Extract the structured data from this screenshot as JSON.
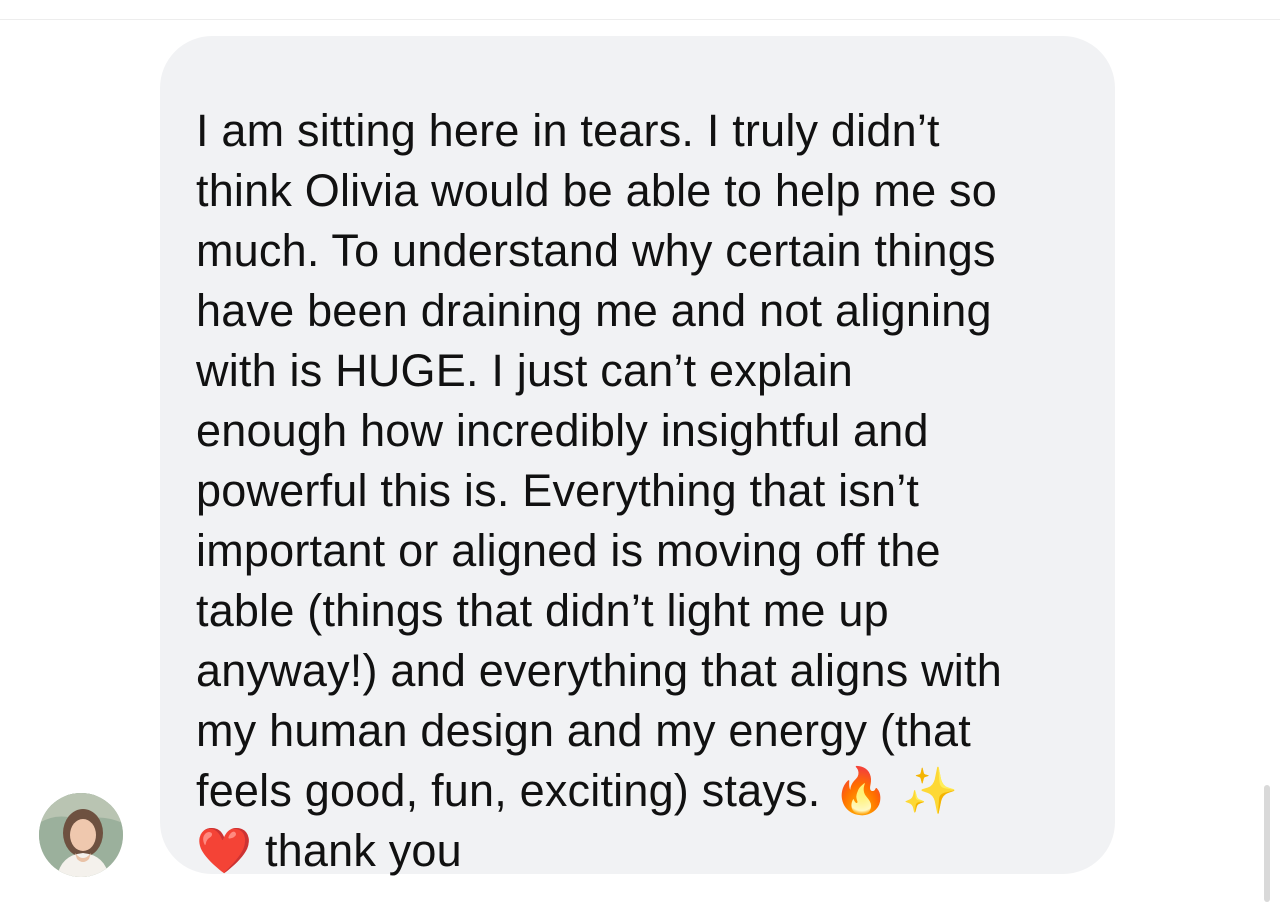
{
  "message": {
    "lines": [
      "I am sitting here in tears. I truly didn’t",
      "think Olivia would be able to help me so",
      "much. To understand why certain things",
      "have been draining me and not aligning",
      "with is HUGE. I just can’t explain",
      "enough how incredibly insightful and",
      "powerful this is. Everything that isn’t",
      "important or aligned is moving off the",
      "table (things that didn’t light me up",
      "anyway!) and everything that aligns with",
      "my human design and my energy (that",
      "feels good, fun, exciting) stays."
    ],
    "emoji_fire": "🔥",
    "emoji_sparkles": "✨",
    "emoji_heart": "❤️",
    "closing": "thank you"
  },
  "colors": {
    "bubble_background": "#f1f2f4",
    "text": "#111111"
  },
  "icons": {
    "avatar": "sender-avatar"
  }
}
